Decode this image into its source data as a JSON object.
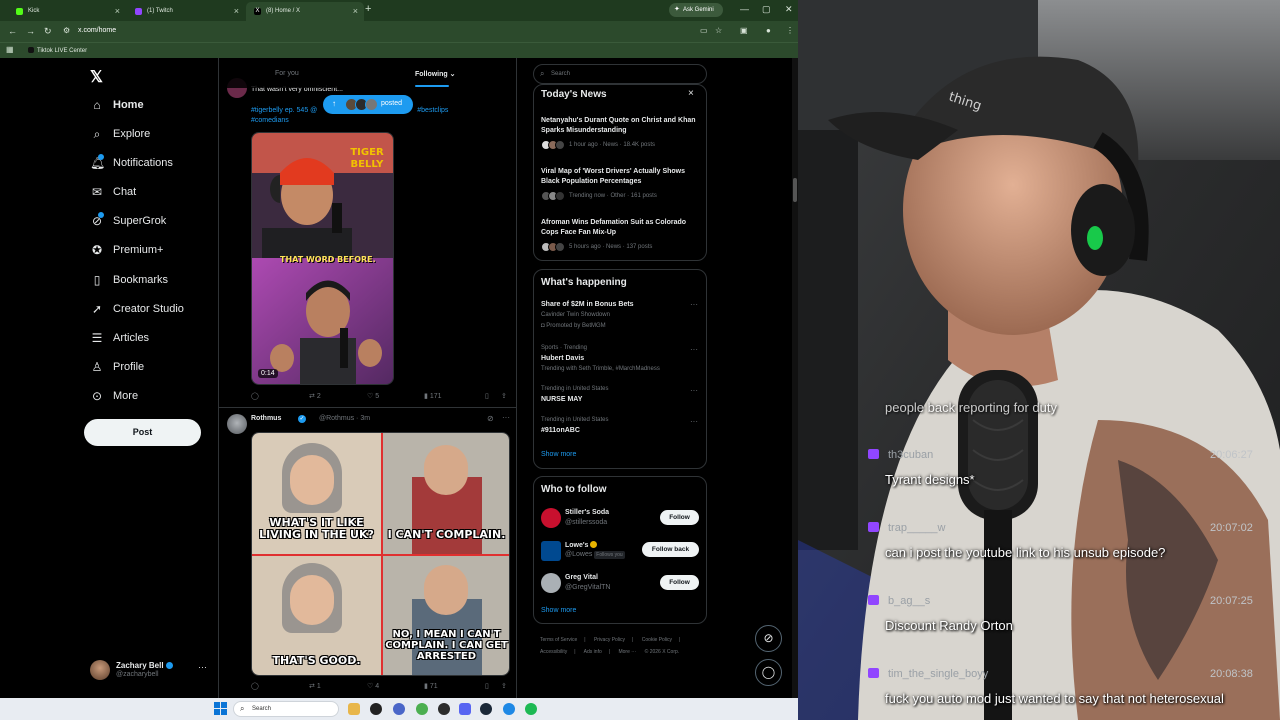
{
  "browser": {
    "tabs": [
      {
        "label": "Kick",
        "color": "#53fc18"
      },
      {
        "label": "(1) Twitch",
        "color": "#9146ff"
      },
      {
        "label": "(8) Home / X",
        "color": "#000000"
      }
    ],
    "new_tab": "+",
    "ask_gemini": "Ask Gemini",
    "url": "x.com/home",
    "bookmark": "Tiktok LIVE Center"
  },
  "x": {
    "logo": "𝕏",
    "nav": [
      {
        "label": "Home",
        "icon": "home-icon"
      },
      {
        "label": "Explore",
        "icon": "search-icon"
      },
      {
        "label": "Notifications",
        "icon": "bell-icon"
      },
      {
        "label": "Chat",
        "icon": "mail-icon"
      },
      {
        "label": "SuperGrok",
        "icon": "grok-icon"
      },
      {
        "label": "Premium+",
        "icon": "premium-icon"
      },
      {
        "label": "Bookmarks",
        "icon": "bookmark-icon"
      },
      {
        "label": "Creator Studio",
        "icon": "rocket-icon"
      },
      {
        "label": "Articles",
        "icon": "article-icon"
      },
      {
        "label": "Profile",
        "icon": "person-icon"
      },
      {
        "label": "More",
        "icon": "more-icon"
      }
    ],
    "post_button": "Post",
    "account": {
      "name": "Zachary Bell",
      "handle": "@zacharybell"
    },
    "timeline": {
      "tab_foryou": "For you",
      "tab_following": "Following",
      "posted_pill": "posted",
      "tweet1": {
        "text": "That wasn't very omniscient...",
        "tags_line1": "#tigerbelly ep. 545 @",
        "tags_line1_end": "#bestclips",
        "tags_line2": "#comedians",
        "video_time": "0:14",
        "video_caption1": "TIGER BELLY",
        "video_caption2": "THAT WORD BEFORE.",
        "retweets": "2",
        "likes": "5",
        "views": "171"
      },
      "tweet2": {
        "name": "Rothmus",
        "handle": "@Rothmus · 3m",
        "meme": [
          "WHAT'S IT LIKE LIVING IN THE UK?",
          "I CAN'T COMPLAIN.",
          "THAT'S GOOD.",
          "NO, I MEAN I CAN'T COMPLAIN. I CAN GET ARRESTED"
        ],
        "retweets": "1",
        "likes": "4",
        "views": "71"
      }
    },
    "search_placeholder": "Search",
    "todays_news": {
      "title": "Today's News",
      "items": [
        {
          "title": "Netanyahu's Durant Quote on Christ and Khan Sparks Misunderstanding",
          "meta": "1 hour ago · News · 18.4K posts"
        },
        {
          "title": "Viral Map of 'Worst Drivers' Actually Shows Black Population Percentages",
          "meta": "Trending now · Other · 161 posts"
        },
        {
          "title": "Afroman Wins Defamation Suit as Colorado Cops Face Fan Mix-Up",
          "meta": "5 hours ago · News · 137 posts"
        }
      ]
    },
    "whats_happening": {
      "title": "What's happening",
      "items": [
        {
          "meta": "",
          "title": "Share of $2M in Bonus Bets",
          "sub": "Cavinder Twin Showdown",
          "sub2": "Promoted by BetMGM"
        },
        {
          "meta": "Sports · Trending",
          "title": "Hubert Davis",
          "sub": "Trending with Seth Trimble, #MarchMadness",
          "sub2": ""
        },
        {
          "meta": "Trending in United States",
          "title": "NURSE MAY",
          "sub": "",
          "sub2": ""
        },
        {
          "meta": "Trending in United States",
          "title": "#911onABC",
          "sub": "",
          "sub2": ""
        }
      ],
      "show_more": "Show more"
    },
    "who_to_follow": {
      "title": "Who to follow",
      "items": [
        {
          "name": "Stiller's Soda",
          "handle": "@stillerssoda",
          "button": "Follow"
        },
        {
          "name": "Lowe's",
          "handle": "@Lowes",
          "badge": "Follows you",
          "button": "Follow back"
        },
        {
          "name": "Greg Vital",
          "handle": "@GregVitalTN",
          "button": "Follow"
        }
      ],
      "show_more": "Show more"
    },
    "footer": [
      "Terms of Service",
      "|",
      "Privacy Policy",
      "|",
      "Cookie Policy",
      "|",
      "Accessibility",
      "|",
      "Ads info",
      "|",
      "More ···",
      "© 2026 X Corp."
    ]
  },
  "taskbar": {
    "search": "Search"
  },
  "chat": [
    {
      "user": "",
      "time": "",
      "text": "people back reporting for duty"
    },
    {
      "user": "th3cuban",
      "time": "20:06:27",
      "text": "Tyrant designs*"
    },
    {
      "user": "trap_____w",
      "time": "20:07:02",
      "text": "can i post the youtube link to his unsub episode?"
    },
    {
      "user": "b_ag__s",
      "time": "20:07:25",
      "text": "Discount Randy Orton"
    },
    {
      "user": "tim_the_single_boyy",
      "time": "20:08:38",
      "text": "fuck you auto mod just wanted to say that not heterosexual"
    }
  ]
}
